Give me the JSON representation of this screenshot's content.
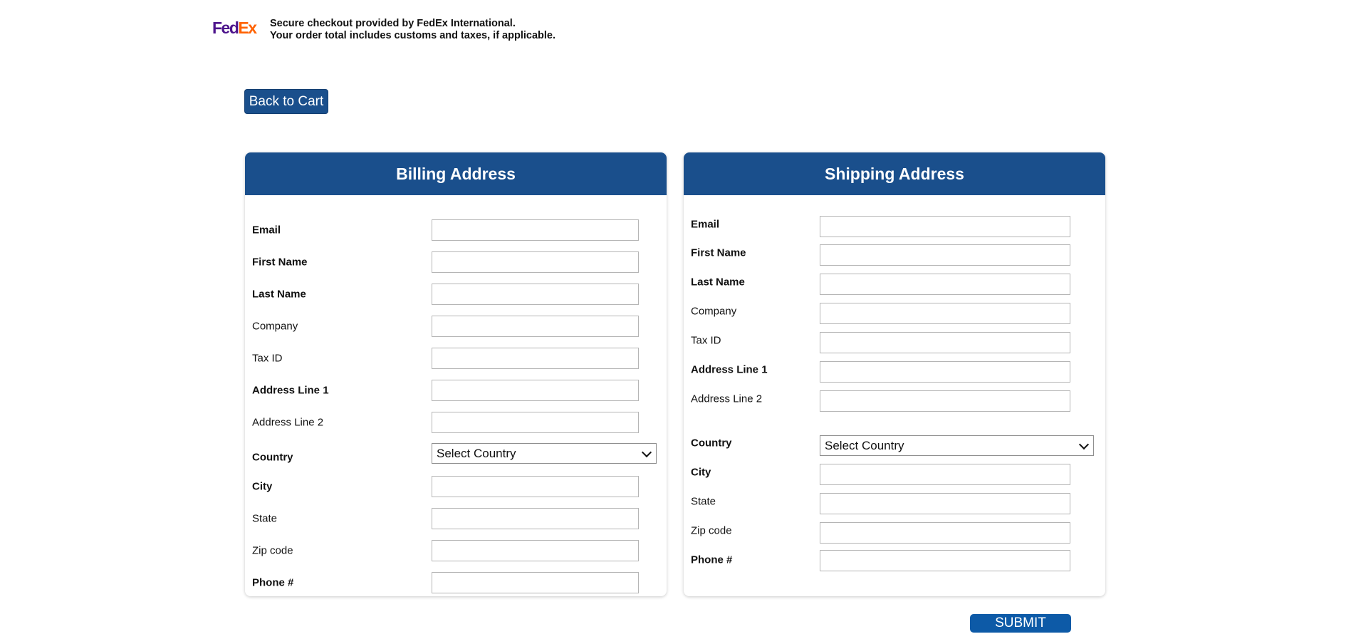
{
  "header": {
    "logo_part1": "Fed",
    "logo_part2": "Ex",
    "notice_line1": "Secure checkout provided by FedEx International.",
    "notice_line2": "Your order total includes customs and taxes, if applicable."
  },
  "back_button": "Back to Cart",
  "billing": {
    "title": "Billing Address",
    "fields": [
      {
        "label": "Email",
        "required": true,
        "value": ""
      },
      {
        "label": "First Name",
        "required": true,
        "value": ""
      },
      {
        "label": "Last Name",
        "required": true,
        "value": ""
      },
      {
        "label": "Company",
        "required": false,
        "value": ""
      },
      {
        "label": "Tax ID",
        "required": false,
        "value": ""
      },
      {
        "label": "Address Line 1",
        "required": true,
        "value": ""
      },
      {
        "label": "Address Line 2",
        "required": false,
        "value": ""
      },
      {
        "label": "Country",
        "required": true,
        "value": "Select Country"
      },
      {
        "label": "City",
        "required": true,
        "value": ""
      },
      {
        "label": "State",
        "required": false,
        "value": ""
      },
      {
        "label": "Zip code",
        "required": false,
        "value": ""
      },
      {
        "label": "Phone #",
        "required": true,
        "value": ""
      }
    ]
  },
  "shipping": {
    "title": "Shipping Address",
    "fields": [
      {
        "label": "Email",
        "required": true,
        "value": ""
      },
      {
        "label": "First Name",
        "required": true,
        "value": ""
      },
      {
        "label": "Last Name",
        "required": true,
        "value": ""
      },
      {
        "label": "Company",
        "required": false,
        "value": ""
      },
      {
        "label": "Tax ID",
        "required": false,
        "value": ""
      },
      {
        "label": "Address Line 1",
        "required": true,
        "value": ""
      },
      {
        "label": "Address Line 2",
        "required": false,
        "value": ""
      },
      {
        "label": "Country",
        "required": true,
        "value": "Select Country"
      },
      {
        "label": "City",
        "required": true,
        "value": ""
      },
      {
        "label": "State",
        "required": false,
        "value": ""
      },
      {
        "label": "Zip code",
        "required": false,
        "value": ""
      },
      {
        "label": "Phone #",
        "required": true,
        "value": ""
      }
    ]
  },
  "submit_button": "SUBMIT",
  "colors": {
    "header_blue": "#1a4f8c",
    "submit_blue": "#0d5aa7",
    "fedex_purple": "#4d148c",
    "fedex_orange": "#ff6200"
  }
}
